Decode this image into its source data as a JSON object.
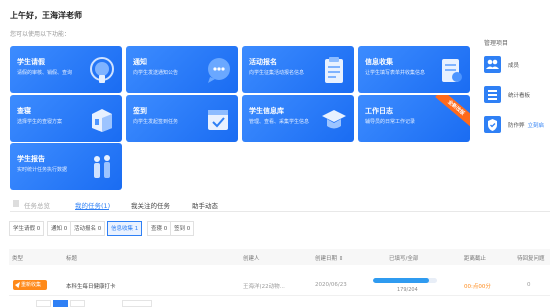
{
  "header": {
    "greeting": "上午好，王海洋老师",
    "subtitle": "您可以使用以下功能："
  },
  "tiles": [
    {
      "title": "学生请假",
      "desc": "请假的审核、销假、查询"
    },
    {
      "title": "通知",
      "desc": "向学生发送通知公告"
    },
    {
      "title": "活动报名",
      "desc": "向学生征集活动报名信息"
    },
    {
      "title": "信息收集",
      "desc": "让学生填写表单并收集信息"
    },
    {
      "title": "查寝",
      "desc": "选择学生的查寝方案"
    },
    {
      "title": "签到",
      "desc": "向学生发起签到任务"
    },
    {
      "title": "学生信息库",
      "desc": "管理、查看、采集学生信息"
    },
    {
      "title": "工作日志",
      "desc": "辅导员的日常工作记录",
      "ribbon": "全新改版"
    },
    {
      "title": "学生报告",
      "desc": "实时统计任务执行数据"
    }
  ],
  "management": {
    "title": "管理项目",
    "items": [
      {
        "label": "成员",
        "icon": "members-icon"
      },
      {
        "label": "统计看板",
        "icon": "dashboard-icon"
      },
      {
        "label": "防作弊",
        "link": "立刻启",
        "icon": "anti-cheat-icon"
      }
    ]
  },
  "tabs": [
    {
      "label": "任务总览"
    },
    {
      "label": "我的任务(1)"
    },
    {
      "label": "我关注的任务"
    },
    {
      "label": "助手动态"
    }
  ],
  "filters": [
    {
      "label": "学生请假 0"
    },
    {
      "label": "通知 0"
    },
    {
      "label": "活动报名 0"
    },
    {
      "label": "信息收集 1"
    },
    {
      "label": "查寝 0"
    },
    {
      "label": "签到 0"
    }
  ],
  "table": {
    "headers": [
      "类型",
      "标题",
      "创建人",
      "创建日期 ⇕",
      "已填写/全部",
      "距离截止",
      "待回复问题"
    ],
    "rows": [
      {
        "type": "重新收集",
        "title": "本科生每日健康打卡",
        "creator": "王海洋(22动物...",
        "date": "2020/06/23",
        "progress_text": "179/204",
        "progress": 0.877,
        "deadline": "00:点00分",
        "questions": "0"
      }
    ]
  },
  "colors": {
    "accent": "#2f80f5",
    "tile": "#2a7cf8",
    "badge": "#ff8a1a",
    "ribbon": "#ff6a1a"
  }
}
